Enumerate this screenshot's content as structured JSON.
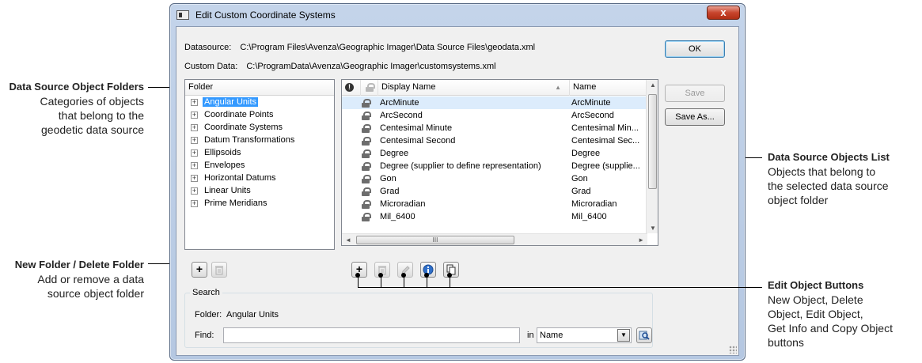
{
  "window": {
    "title": "Edit Custom Coordinate Systems",
    "close_glyph": "x"
  },
  "paths": {
    "datasource_label": "Datasource:",
    "datasource_value": "C:\\Program Files\\Avenza\\Geographic Imager\\Data Source Files\\geodata.xml",
    "custom_label": "Custom Data:",
    "custom_value": "C:\\ProgramData\\Avenza\\Geographic Imager\\customsystems.xml"
  },
  "buttons": {
    "ok": "OK",
    "save": "Save",
    "save_as": "Save As..."
  },
  "folder_tree": {
    "header": "Folder",
    "items": [
      {
        "label": "Angular Units",
        "selected": true
      },
      {
        "label": "Coordinate Points"
      },
      {
        "label": "Coordinate Systems"
      },
      {
        "label": "Datum Transformations"
      },
      {
        "label": "Ellipsoids"
      },
      {
        "label": "Envelopes"
      },
      {
        "label": "Horizontal Datums"
      },
      {
        "label": "Linear Units"
      },
      {
        "label": "Prime Meridians"
      }
    ]
  },
  "object_list": {
    "columns": {
      "display": "Display Name",
      "name": "Name"
    },
    "rows": [
      {
        "display": "ArcMinute",
        "name": "ArcMinute"
      },
      {
        "display": "ArcSecond",
        "name": "ArcSecond"
      },
      {
        "display": "Centesimal Minute",
        "name": "Centesimal Min..."
      },
      {
        "display": "Centesimal Second",
        "name": "Centesimal Sec..."
      },
      {
        "display": "Degree",
        "name": "Degree"
      },
      {
        "display": "Degree (supplier to define representation)",
        "name": "Degree (supplie..."
      },
      {
        "display": "Gon",
        "name": "Gon"
      },
      {
        "display": "Grad",
        "name": "Grad"
      },
      {
        "display": "Microradian",
        "name": "Microradian"
      },
      {
        "display": "Mil_6400",
        "name": "Mil_6400"
      }
    ],
    "hscroll_thumb": "III"
  },
  "search": {
    "legend": "Search",
    "folder_label": "Folder:",
    "folder_value": "Angular Units",
    "find_label": "Find:",
    "find_value": "",
    "in_label": "in",
    "in_value": "Name"
  },
  "annotations": {
    "folders": {
      "title": "Data Source Object Folders",
      "lines": [
        "Categories of objects",
        "that belong to the",
        "geodetic data source"
      ]
    },
    "new_folder": {
      "title": "New Folder / Delete Folder",
      "lines": [
        "Add or remove a data",
        "source object folder"
      ]
    },
    "objects_list": {
      "title": "Data Source Objects List",
      "lines": [
        "Objects that belong to",
        "the selected data source",
        "object folder"
      ]
    },
    "edit_buttons": {
      "title": "Edit Object Buttons",
      "lines": [
        "New Object, Delete",
        "Object, Edit Object,",
        "Get Info and Copy Object",
        "buttons"
      ]
    }
  },
  "colors": {
    "selection": "#3399ff",
    "title_bar": "#c4d4ea",
    "close": "#c8452e"
  }
}
